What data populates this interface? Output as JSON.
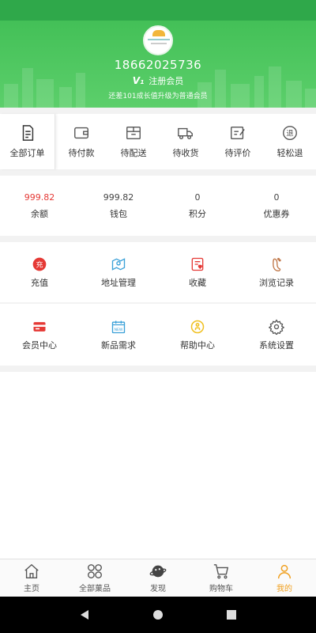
{
  "header": {
    "phone": "18662025736",
    "member_badge": "V₁",
    "member_label": "注册会员",
    "upgrade_hint": "还差101成长值升级为普通会员"
  },
  "orders": {
    "all": "全部订单",
    "items": [
      {
        "label": "待付款",
        "icon": "wallet-icon"
      },
      {
        "label": "待配送",
        "icon": "package-icon"
      },
      {
        "label": "待收货",
        "icon": "truck-icon"
      },
      {
        "label": "待评价",
        "icon": "review-icon"
      },
      {
        "label": "轻松退",
        "icon": "refund-icon"
      }
    ]
  },
  "wallet": {
    "items": [
      {
        "value": "999.82",
        "label": "余额"
      },
      {
        "value": "999.82",
        "label": "钱包"
      },
      {
        "value": "0",
        "label": "积分"
      },
      {
        "value": "0",
        "label": "优惠券"
      }
    ]
  },
  "services": {
    "row1": [
      {
        "label": "充值",
        "icon": "recharge-icon"
      },
      {
        "label": "地址管理",
        "icon": "map-icon"
      },
      {
        "label": "收藏",
        "icon": "favorite-icon"
      },
      {
        "label": "浏览记录",
        "icon": "footprint-icon"
      }
    ],
    "row2": [
      {
        "label": "会员中心",
        "icon": "card-icon"
      },
      {
        "label": "新品需求",
        "icon": "new-icon"
      },
      {
        "label": "帮助中心",
        "icon": "help-icon"
      },
      {
        "label": "系统设置",
        "icon": "settings-icon"
      }
    ]
  },
  "tabbar": [
    {
      "label": "主页",
      "icon": "home-icon"
    },
    {
      "label": "全部菓品",
      "icon": "grid-icon"
    },
    {
      "label": "发现",
      "icon": "planet-icon"
    },
    {
      "label": "购物车",
      "icon": "cart-icon"
    },
    {
      "label": "我的",
      "icon": "person-icon"
    }
  ],
  "colors": {
    "header_green": "#43c057",
    "balance_red": "#e53935",
    "active_tab": "#f0a020"
  }
}
